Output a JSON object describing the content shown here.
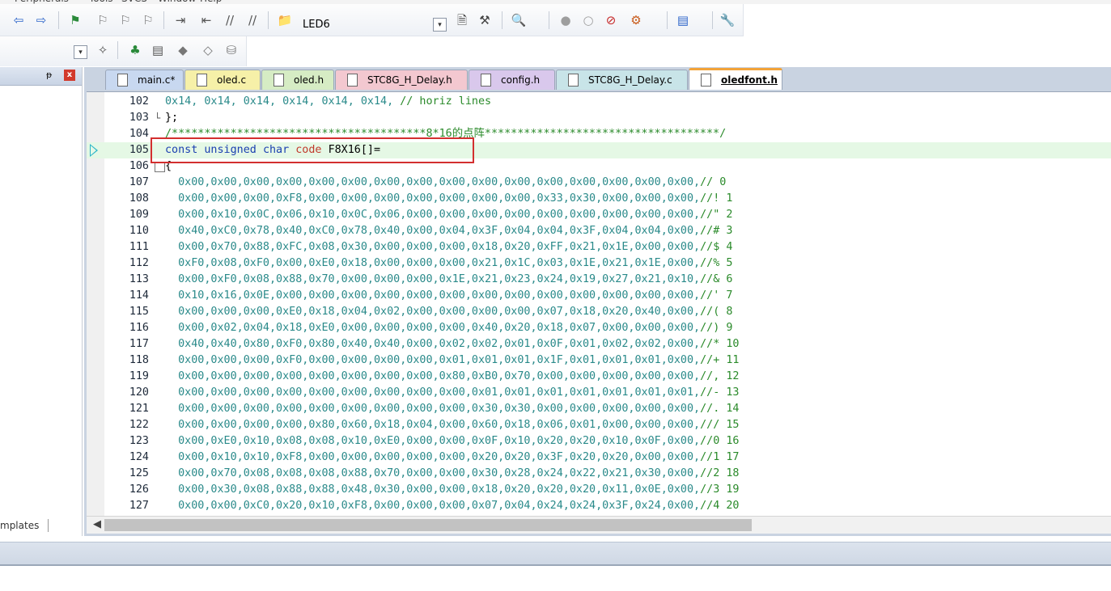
{
  "menubar": {
    "items": [
      "Peripherals",
      "Tools",
      "SVCS",
      "Window",
      "Help"
    ]
  },
  "toolbar1": {
    "buttons": [
      {
        "name": "navigate-back-icon",
        "glyph": "⇦"
      },
      {
        "name": "navigate-forward-icon",
        "glyph": "⇨"
      },
      {
        "name": "insert-bookmark-icon",
        "glyph": "⚑"
      },
      {
        "name": "previous-bookmark-icon",
        "glyph": "⚐"
      },
      {
        "name": "next-bookmark-icon",
        "glyph": "⚐"
      },
      {
        "name": "clear-bookmarks-icon",
        "glyph": "⚐"
      },
      {
        "name": "indent-icon",
        "glyph": "⇥"
      },
      {
        "name": "unindent-icon",
        "glyph": "⇤"
      },
      {
        "name": "comment-icon",
        "glyph": "//"
      },
      {
        "name": "uncomment-icon",
        "glyph": "//"
      },
      {
        "name": "find-in-files-icon",
        "glyph": "📁"
      }
    ],
    "target_name": "LED6",
    "right_buttons": [
      {
        "name": "target-dropdown-icon",
        "glyph": "▾"
      },
      {
        "name": "options-icon",
        "glyph": "🗎"
      },
      {
        "name": "manage-components-icon",
        "glyph": "⚒"
      },
      {
        "name": "debug-session-icon",
        "glyph": "🔍"
      },
      {
        "name": "breakpoint-icon",
        "glyph": "●"
      },
      {
        "name": "disable-breakpoint-icon",
        "glyph": "○"
      },
      {
        "name": "kill-breakpoints-icon",
        "glyph": "⊘"
      },
      {
        "name": "debug-options-icon",
        "glyph": "⚙"
      },
      {
        "name": "window-layout-icon",
        "glyph": "▤"
      },
      {
        "name": "configure-icon",
        "glyph": "🔧"
      }
    ]
  },
  "toolbar2": {
    "buttons": [
      {
        "name": "rebuild-dropdown-icon",
        "glyph": "▾"
      },
      {
        "name": "magic-wand-icon",
        "glyph": "✧"
      },
      {
        "name": "manage-project-icon",
        "glyph": "♣"
      },
      {
        "name": "file-extensions-icon",
        "glyph": "▤"
      },
      {
        "name": "pack-installer-icon",
        "glyph": "◆"
      },
      {
        "name": "select-software-packs-icon",
        "glyph": "◇"
      },
      {
        "name": "run-time-environment-icon",
        "glyph": "⛁"
      }
    ]
  },
  "left_panel": {
    "pin_glyph": "ᵽ",
    "close_glyph": "x",
    "bottom_tab": "mplates"
  },
  "tabs": [
    {
      "label": "main.c*",
      "color": "#c8d8f0",
      "active": false
    },
    {
      "label": "oled.c",
      "color": "#f6f0a8",
      "active": false
    },
    {
      "label": "oled.h",
      "color": "#d6ecc4",
      "active": false
    },
    {
      "label": "STC8G_H_Delay.h",
      "color": "#f3c8d0",
      "active": false
    },
    {
      "label": "config.h",
      "color": "#d9c8ec",
      "active": false
    },
    {
      "label": "STC8G_H_Delay.c",
      "color": "#c8e4e8",
      "active": false
    },
    {
      "label": "oledfont.h",
      "color": "#fbe4c8",
      "active": true
    }
  ],
  "code": {
    "current_line": 105,
    "lines": [
      {
        "n": "102",
        "fold": "",
        "text": "0x14, 0x14, 0x14, 0x14, 0x14, 0x14,",
        "comment": "// horiz lines"
      },
      {
        "n": "103",
        "fold": "-",
        "text": "};",
        "comment": ""
      },
      {
        "n": "104",
        "fold": "",
        "text": "",
        "comment": "/***************************************8*16的点阵************************************/"
      },
      {
        "n": "105",
        "fold": "",
        "decl": [
          "const",
          "unsigned",
          "char",
          "code",
          "F8X16[]="
        ],
        "text": "",
        "comment": ""
      },
      {
        "n": "106",
        "fold": "",
        "text": "{",
        "comment": ""
      },
      {
        "n": "107",
        "fold": "",
        "text": "  0x00,0x00,0x00,0x00,0x00,0x00,0x00,0x00,0x00,0x00,0x00,0x00,0x00,0x00,0x00,0x00,",
        "comment": "// 0"
      },
      {
        "n": "108",
        "fold": "",
        "text": "  0x00,0x00,0x00,0xF8,0x00,0x00,0x00,0x00,0x00,0x00,0x00,0x33,0x30,0x00,0x00,0x00,",
        "comment": "//! 1"
      },
      {
        "n": "109",
        "fold": "",
        "text": "  0x00,0x10,0x0C,0x06,0x10,0x0C,0x06,0x00,0x00,0x00,0x00,0x00,0x00,0x00,0x00,0x00,",
        "comment": "//\" 2"
      },
      {
        "n": "110",
        "fold": "",
        "text": "  0x40,0xC0,0x78,0x40,0xC0,0x78,0x40,0x00,0x04,0x3F,0x04,0x04,0x3F,0x04,0x04,0x00,",
        "comment": "//# 3"
      },
      {
        "n": "111",
        "fold": "",
        "text": "  0x00,0x70,0x88,0xFC,0x08,0x30,0x00,0x00,0x00,0x18,0x20,0xFF,0x21,0x1E,0x00,0x00,",
        "comment": "//$ 4"
      },
      {
        "n": "112",
        "fold": "",
        "text": "  0xF0,0x08,0xF0,0x00,0xE0,0x18,0x00,0x00,0x00,0x21,0x1C,0x03,0x1E,0x21,0x1E,0x00,",
        "comment": "//% 5"
      },
      {
        "n": "113",
        "fold": "",
        "text": "  0x00,0xF0,0x08,0x88,0x70,0x00,0x00,0x00,0x1E,0x21,0x23,0x24,0x19,0x27,0x21,0x10,",
        "comment": "//& 6"
      },
      {
        "n": "114",
        "fold": "",
        "text": "  0x10,0x16,0x0E,0x00,0x00,0x00,0x00,0x00,0x00,0x00,0x00,0x00,0x00,0x00,0x00,0x00,",
        "comment": "//' 7"
      },
      {
        "n": "115",
        "fold": "",
        "text": "  0x00,0x00,0x00,0xE0,0x18,0x04,0x02,0x00,0x00,0x00,0x00,0x07,0x18,0x20,0x40,0x00,",
        "comment": "//( 8"
      },
      {
        "n": "116",
        "fold": "",
        "text": "  0x00,0x02,0x04,0x18,0xE0,0x00,0x00,0x00,0x00,0x40,0x20,0x18,0x07,0x00,0x00,0x00,",
        "comment": "//) 9"
      },
      {
        "n": "117",
        "fold": "",
        "text": "  0x40,0x40,0x80,0xF0,0x80,0x40,0x40,0x00,0x02,0x02,0x01,0x0F,0x01,0x02,0x02,0x00,",
        "comment": "//* 10"
      },
      {
        "n": "118",
        "fold": "",
        "text": "  0x00,0x00,0x00,0xF0,0x00,0x00,0x00,0x00,0x01,0x01,0x01,0x1F,0x01,0x01,0x01,0x00,",
        "comment": "//+ 11"
      },
      {
        "n": "119",
        "fold": "",
        "text": "  0x00,0x00,0x00,0x00,0x00,0x00,0x00,0x00,0x80,0xB0,0x70,0x00,0x00,0x00,0x00,0x00,",
        "comment": "//, 12"
      },
      {
        "n": "120",
        "fold": "",
        "text": "  0x00,0x00,0x00,0x00,0x00,0x00,0x00,0x00,0x00,0x01,0x01,0x01,0x01,0x01,0x01,0x01,",
        "comment": "//- 13"
      },
      {
        "n": "121",
        "fold": "",
        "text": "  0x00,0x00,0x00,0x00,0x00,0x00,0x00,0x00,0x00,0x30,0x30,0x00,0x00,0x00,0x00,0x00,",
        "comment": "//. 14"
      },
      {
        "n": "122",
        "fold": "",
        "text": "  0x00,0x00,0x00,0x00,0x80,0x60,0x18,0x04,0x00,0x60,0x18,0x06,0x01,0x00,0x00,0x00,",
        "comment": "/// 15"
      },
      {
        "n": "123",
        "fold": "",
        "text": "  0x00,0xE0,0x10,0x08,0x08,0x10,0xE0,0x00,0x00,0x0F,0x10,0x20,0x20,0x10,0x0F,0x00,",
        "comment": "//0 16"
      },
      {
        "n": "124",
        "fold": "",
        "text": "  0x00,0x10,0x10,0xF8,0x00,0x00,0x00,0x00,0x00,0x20,0x20,0x3F,0x20,0x20,0x00,0x00,",
        "comment": "//1 17"
      },
      {
        "n": "125",
        "fold": "",
        "text": "  0x00,0x70,0x08,0x08,0x08,0x88,0x70,0x00,0x00,0x30,0x28,0x24,0x22,0x21,0x30,0x00,",
        "comment": "//2 18"
      },
      {
        "n": "126",
        "fold": "",
        "text": "  0x00,0x30,0x08,0x88,0x88,0x48,0x30,0x00,0x00,0x18,0x20,0x20,0x20,0x11,0x0E,0x00,",
        "comment": "//3 19"
      },
      {
        "n": "127",
        "fold": "",
        "text": "  0x00,0x00,0xC0,0x20,0x10,0xF8,0x00,0x00,0x00,0x07,0x04,0x24,0x24,0x3F,0x24,0x00,",
        "comment": "//4 20"
      }
    ]
  },
  "colors": {
    "highlight_box": "#d32f2f",
    "current_line_bg": "#e5f8e5",
    "hex_literal": "#2a8a8a",
    "keyword": "#1a3fb0"
  }
}
